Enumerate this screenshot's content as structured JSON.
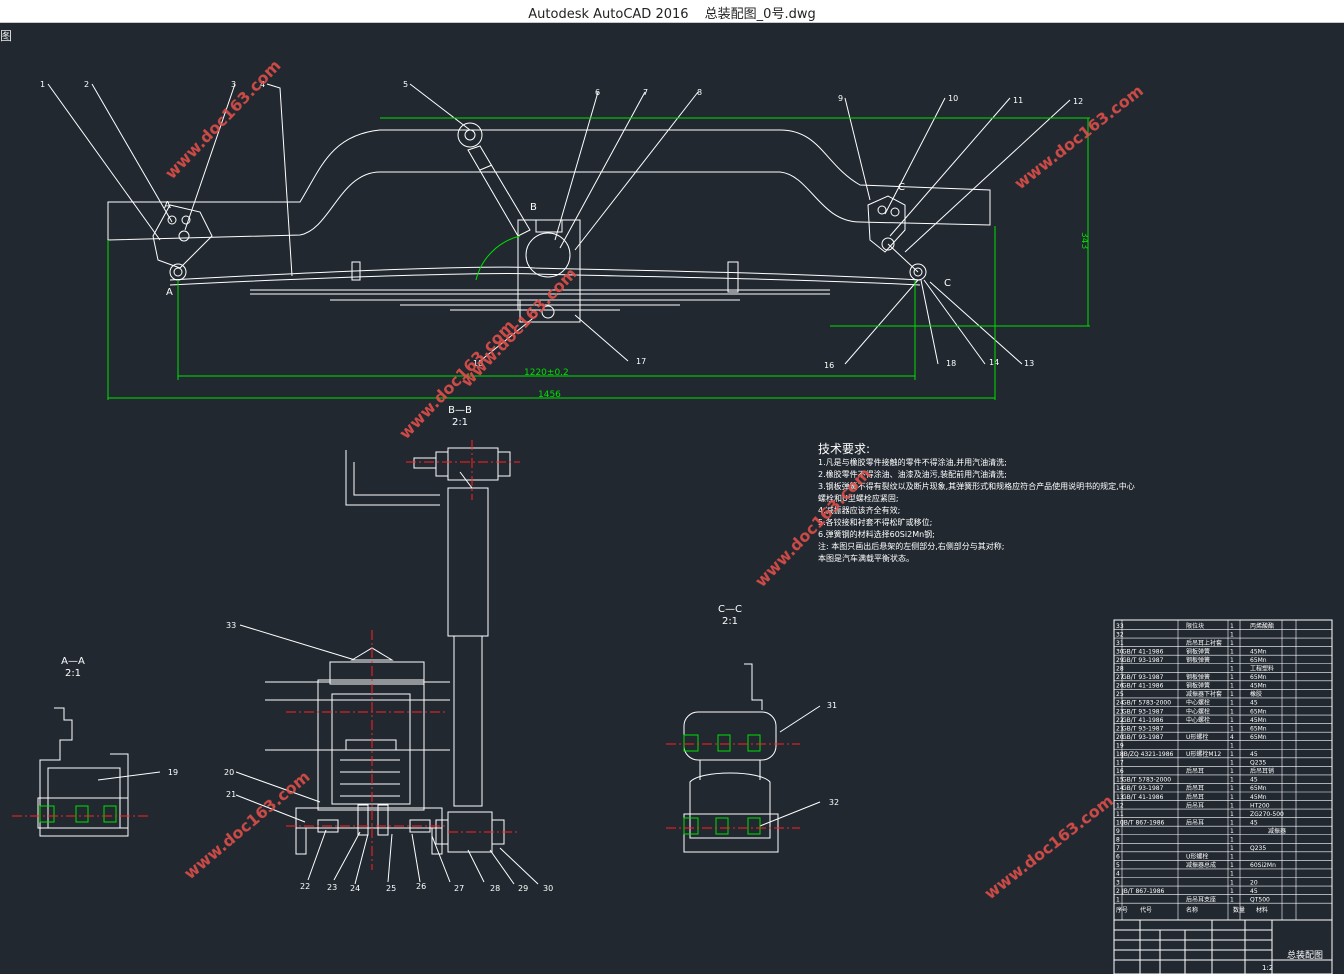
{
  "window": {
    "app_title": "Autodesk AutoCAD 2016",
    "file_name": "总装配图_0号.dwg"
  },
  "viewport": {
    "corner_label": "图"
  },
  "drawing": {
    "callouts_top": [
      "1",
      "2",
      "3",
      "4",
      "5",
      "6",
      "7",
      "8",
      "9",
      "10",
      "11",
      "12"
    ],
    "callouts_bottom_row": [
      "18",
      "17",
      "16",
      "18",
      "14",
      "13"
    ],
    "section_labels": {
      "a": "A",
      "b": "B",
      "c": "C"
    },
    "dimensions": {
      "span_center": "1220±0.2",
      "span_total": "1456",
      "height": "343"
    },
    "views": {
      "bb_title": "B—B",
      "bb_scale": "2:1",
      "aa_title": "A—A",
      "aa_scale": "2:1",
      "cc_title": "C—C",
      "cc_scale": "2:1"
    },
    "view_callouts": {
      "v33": "33",
      "v20": "20",
      "v21": "21",
      "v22": "22",
      "v23": "23",
      "v24": "24",
      "v25": "25",
      "v26": "26",
      "v27": "27",
      "v28": "28",
      "v29": "29",
      "v30": "30",
      "v19": "19",
      "v31": "31",
      "v32": "32"
    }
  },
  "tech_requirements": {
    "heading": "技术要求:",
    "lines": [
      "1.凡是与橡胶零件接触的零件不得涂油,并用汽油清洗;",
      "2.橡胶零件不得涂油、油漆及油污,装配前用汽油清洗;",
      "3.钢板弹簧不得有裂纹以及断片现象,其弹簧形式和规格应符合产品使用说明书的规定,中心",
      "螺栓和U型螺栓应紧固;",
      "4.减振器应该齐全有效;",
      "5.各铰接和衬套不得松旷或移位;",
      "6.弹簧钢的材料选择60Si2Mn钢;",
      "注: 本图只画出后悬架的左侧部分,右侧部分与其对称;",
      "    本图是汽车满载平衡状态。"
    ]
  },
  "bom": {
    "rows": [
      {
        "no": "33",
        "code": "",
        "name": "限位块",
        "qty": "1",
        "mat": "丙烯酸酯"
      },
      {
        "no": "32",
        "code": "",
        "name": "",
        "qty": "1",
        "mat": ""
      },
      {
        "no": "31",
        "code": "",
        "name": "后吊耳上衬套",
        "qty": "1",
        "mat": ""
      },
      {
        "no": "30",
        "code": "GB/T 41-1986",
        "name": "钢板弹簧",
        "qty": "1",
        "mat": "45Mn"
      },
      {
        "no": "29",
        "code": "GB/T 93-1987",
        "name": "钢板弹簧",
        "qty": "1",
        "mat": "65Mn"
      },
      {
        "no": "28",
        "code": "",
        "name": "",
        "qty": "1",
        "mat": "工程塑料"
      },
      {
        "no": "27",
        "code": "GB/T 93-1987",
        "name": "钢板弹簧",
        "qty": "1",
        "mat": "65Mn"
      },
      {
        "no": "26",
        "code": "GB/T 41-1986",
        "name": "钢板弹簧",
        "qty": "1",
        "mat": "45Mn"
      },
      {
        "no": "25",
        "code": "",
        "name": "减振器下衬套",
        "qty": "1",
        "mat": "橡胶"
      },
      {
        "no": "24",
        "code": "GB/T 5783-2000",
        "name": "中心螺栓",
        "qty": "1",
        "mat": "45"
      },
      {
        "no": "23",
        "code": "GB/T 93-1987",
        "name": "中心螺栓",
        "qty": "1",
        "mat": "65Mn"
      },
      {
        "no": "22",
        "code": "GB/T 41-1986",
        "name": "中心螺栓",
        "qty": "1",
        "mat": "45Mn"
      },
      {
        "no": "21",
        "code": "GB/T 93-1987",
        "name": "",
        "qty": "1",
        "mat": "65Mn"
      },
      {
        "no": "20",
        "code": "GB/T 93-1987",
        "name": "U形螺栓",
        "qty": "4",
        "mat": "65Mn"
      },
      {
        "no": "19",
        "code": "",
        "name": "",
        "qty": "1",
        "mat": ""
      },
      {
        "no": "18",
        "code": "JB/ZQ 4321-1986",
        "name": "U形螺栓M12",
        "qty": "1",
        "mat": "45"
      },
      {
        "no": "17",
        "code": "",
        "name": "",
        "qty": "1",
        "mat": "Q235"
      },
      {
        "no": "16",
        "code": "",
        "name": "后吊耳",
        "qty": "1",
        "mat": "后吊耳销"
      },
      {
        "no": "15",
        "code": "GB/T 5783-2000",
        "name": "",
        "qty": "1",
        "mat": "45"
      },
      {
        "no": "14",
        "code": "GB/T 93-1987",
        "name": "后吊耳",
        "qty": "1",
        "mat": "65Mn"
      },
      {
        "no": "13",
        "code": "GB/T 41-1986",
        "name": "后吊耳",
        "qty": "1",
        "mat": "45Mn"
      },
      {
        "no": "12",
        "code": "",
        "name": "后吊耳",
        "qty": "1",
        "mat": "HT200"
      },
      {
        "no": "11",
        "code": "",
        "name": "",
        "qty": "1",
        "mat": "ZG270-500"
      },
      {
        "no": "10",
        "code": "JB/T 867-1986",
        "name": "后吊耳",
        "qty": "1",
        "mat": "45"
      },
      {
        "no": "9",
        "code": "",
        "name": "",
        "qty": "1",
        "mat": "",
        "extra": "减振器"
      },
      {
        "no": "8",
        "code": "",
        "name": "",
        "qty": "1",
        "mat": ""
      },
      {
        "no": "7",
        "code": "",
        "name": "",
        "qty": "1",
        "mat": "Q235"
      },
      {
        "no": "6",
        "code": "",
        "name": "U形螺栓",
        "qty": "1",
        "mat": ""
      },
      {
        "no": "5",
        "code": "",
        "name": "减振器总成",
        "qty": "1",
        "mat": "60Si2Mn"
      },
      {
        "no": "4",
        "code": "",
        "name": "",
        "qty": "1",
        "mat": ""
      },
      {
        "no": "3",
        "code": "",
        "name": "",
        "qty": "1",
        "mat": "20"
      },
      {
        "no": "2",
        "code": "JB/T 867-1986",
        "name": "",
        "qty": "1",
        "mat": "45"
      },
      {
        "no": "1",
        "code": "",
        "name": "后吊耳支座",
        "qty": "1",
        "mat": "QT500"
      }
    ],
    "header": {
      "no": "序号",
      "code": "代号",
      "name": "名称",
      "qty": "数量",
      "mat": "材料"
    },
    "title_block": {
      "title": "总装配图",
      "scale": "1:2"
    }
  },
  "watermark": {
    "text": "www.doc163.com"
  },
  "colors": {
    "line": "#ffffff",
    "dim": "#00e000",
    "center": "#ff2020",
    "bg": "#212830",
    "watermark": "#e0504a"
  }
}
